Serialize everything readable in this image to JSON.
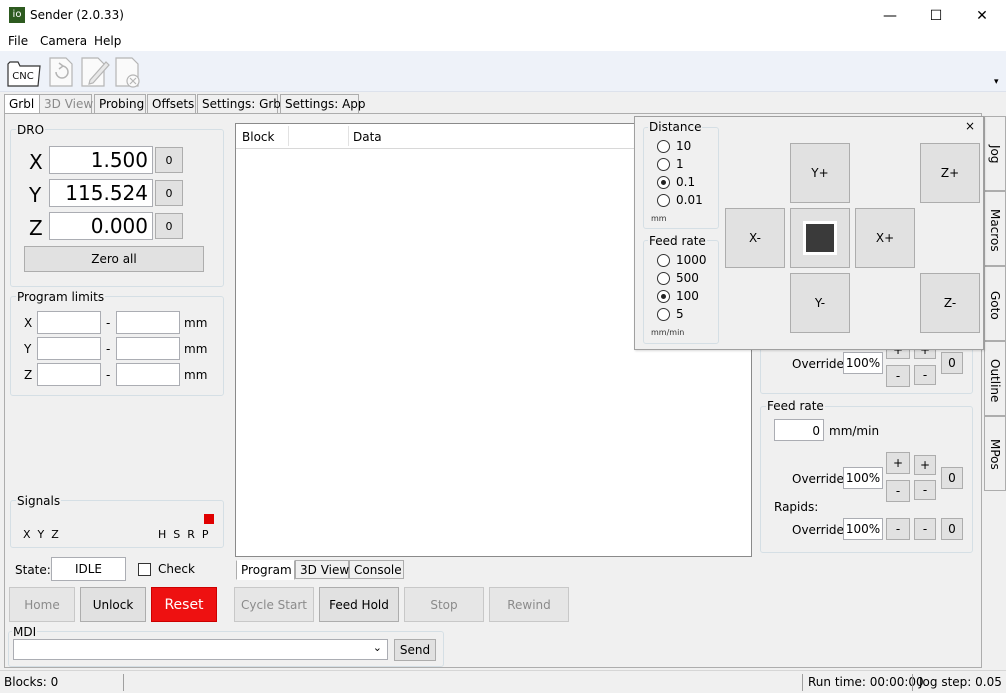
{
  "window": {
    "app_icon": "io",
    "title": "Sender (2.0.33)",
    "minimize": "—",
    "maximize": "☐",
    "close": "✕"
  },
  "menu": {
    "file": "File",
    "camera": "Camera",
    "help": "Help"
  },
  "toolbar": {
    "cnc_label": "CNC"
  },
  "tabs": [
    "Grbl",
    "3D View",
    "Probing",
    "Offsets",
    "Settings: Grbl",
    "Settings: App"
  ],
  "dro": {
    "title": "DRO",
    "x_label": "X",
    "x_value": "1.500",
    "y_label": "Y",
    "y_value": "115.524",
    "z_label": "Z",
    "z_value": "0.000",
    "zero_button": "0",
    "zero_all": "Zero all"
  },
  "limits": {
    "title": "Program limits",
    "x": "X",
    "y": "Y",
    "z": "Z",
    "dash": "-",
    "unit": "mm"
  },
  "signals": {
    "title": "Signals",
    "axes": "X  Y  Z",
    "flags": "H  S  R  P",
    "p_color": "#e00000"
  },
  "state": {
    "label": "State:",
    "value": "IDLE",
    "check": "Check"
  },
  "buttons": {
    "home": "Home",
    "unlock": "Unlock",
    "reset": "Reset",
    "cycle_start": "Cycle Start",
    "feed_hold": "Feed Hold",
    "stop": "Stop",
    "rewind": "Rewind"
  },
  "mdi": {
    "title": "MDI",
    "send": "Send",
    "dropdown": "⌄"
  },
  "program": {
    "col_block": "Block",
    "col_data": "Data"
  },
  "bottom_tabs": [
    "Program",
    "3D View",
    "Console"
  ],
  "spindle": {
    "override_label": "Override",
    "override_value": "100%",
    "plus": "+",
    "minus": "-",
    "reset": "0"
  },
  "feed": {
    "title": "Feed rate",
    "value": "0",
    "unit": "mm/min",
    "override_label": "Override",
    "override_value": "100%",
    "rapids": "Rapids:",
    "rapids_override_label": "Override",
    "rapids_override_value": "100%",
    "plus": "+",
    "minus": "-",
    "reset": "0"
  },
  "side_tabs": [
    "Jog",
    "Macros",
    "Goto",
    "Outline",
    "MPos"
  ],
  "jog": {
    "close": "×",
    "distance_title": "Distance",
    "distance_options": [
      "10",
      "1",
      "0.1",
      "0.01"
    ],
    "distance_selected": "0.1",
    "distance_unit": "mm",
    "feed_title": "Feed rate",
    "feed_options": [
      "1000",
      "500",
      "100",
      "5"
    ],
    "feed_selected": "100",
    "feed_unit": "mm/min",
    "y_plus": "Y+",
    "y_minus": "Y-",
    "x_plus": "X+",
    "x_minus": "X-",
    "z_plus": "Z+",
    "z_minus": "Z-"
  },
  "status": {
    "blocks": "Blocks: 0",
    "run_time": "Run time: 00:00:00",
    "jog_step": "Jog step: 0.05"
  },
  "colors": {
    "reset_red": "#ee1111",
    "title_icon": "#2d5a1f"
  }
}
